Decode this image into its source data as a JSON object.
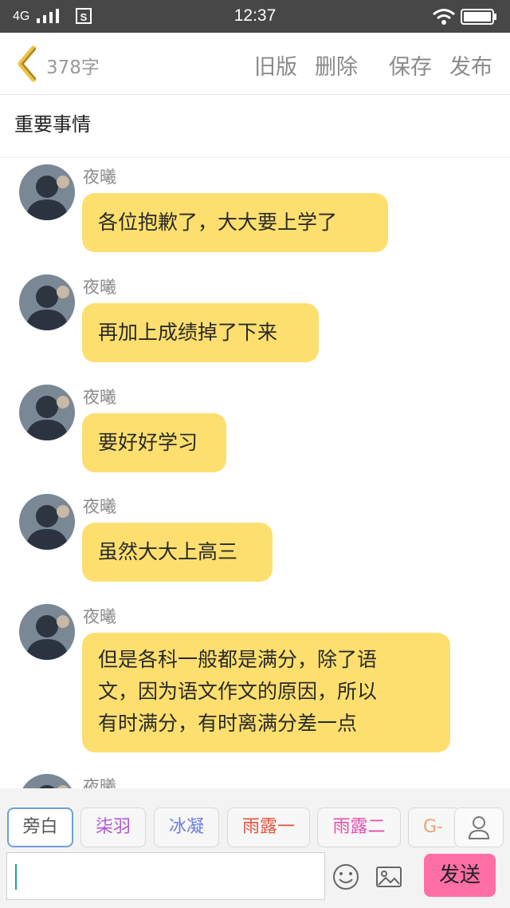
{
  "status_bar": {
    "network": "4G",
    "time": "12:37"
  },
  "header": {
    "word_count": "378字",
    "actions": [
      "旧版",
      "删除",
      "保存",
      "发布"
    ]
  },
  "title": "重要事情",
  "messages": [
    {
      "sender": "夜曦",
      "text": "各位抱歉了，大大要上学了"
    },
    {
      "sender": "夜曦",
      "text": "再加上成绩掉了下来"
    },
    {
      "sender": "夜曦",
      "text": "要好好学习"
    },
    {
      "sender": "夜曦",
      "text": "虽然大大上高三"
    },
    {
      "sender": "夜曦",
      "lines": [
        "但是各科一般都是满分，除了语",
        "文，因为语文作文的原因，所以",
        "有时满分，有时离满分差一点"
      ]
    },
    {
      "sender": "夜曦"
    }
  ],
  "roles": [
    {
      "label": "旁白",
      "color": "#555555"
    },
    {
      "label": "柒羽",
      "color": "#b05ad6"
    },
    {
      "label": "冰凝",
      "color": "#6d7fe0"
    },
    {
      "label": "雨露一",
      "color": "#e0553f"
    },
    {
      "label": "雨露二",
      "color": "#e64fb0"
    },
    {
      "label": "G-D",
      "color": "#f0a070"
    }
  ],
  "composer": {
    "input_value": "",
    "send_label": "发送"
  },
  "colors": {
    "bubble": "#fddf6f",
    "send_button": "#ff6fa6",
    "status_bar": "#474747",
    "back_arrow": "#f0c23a"
  }
}
